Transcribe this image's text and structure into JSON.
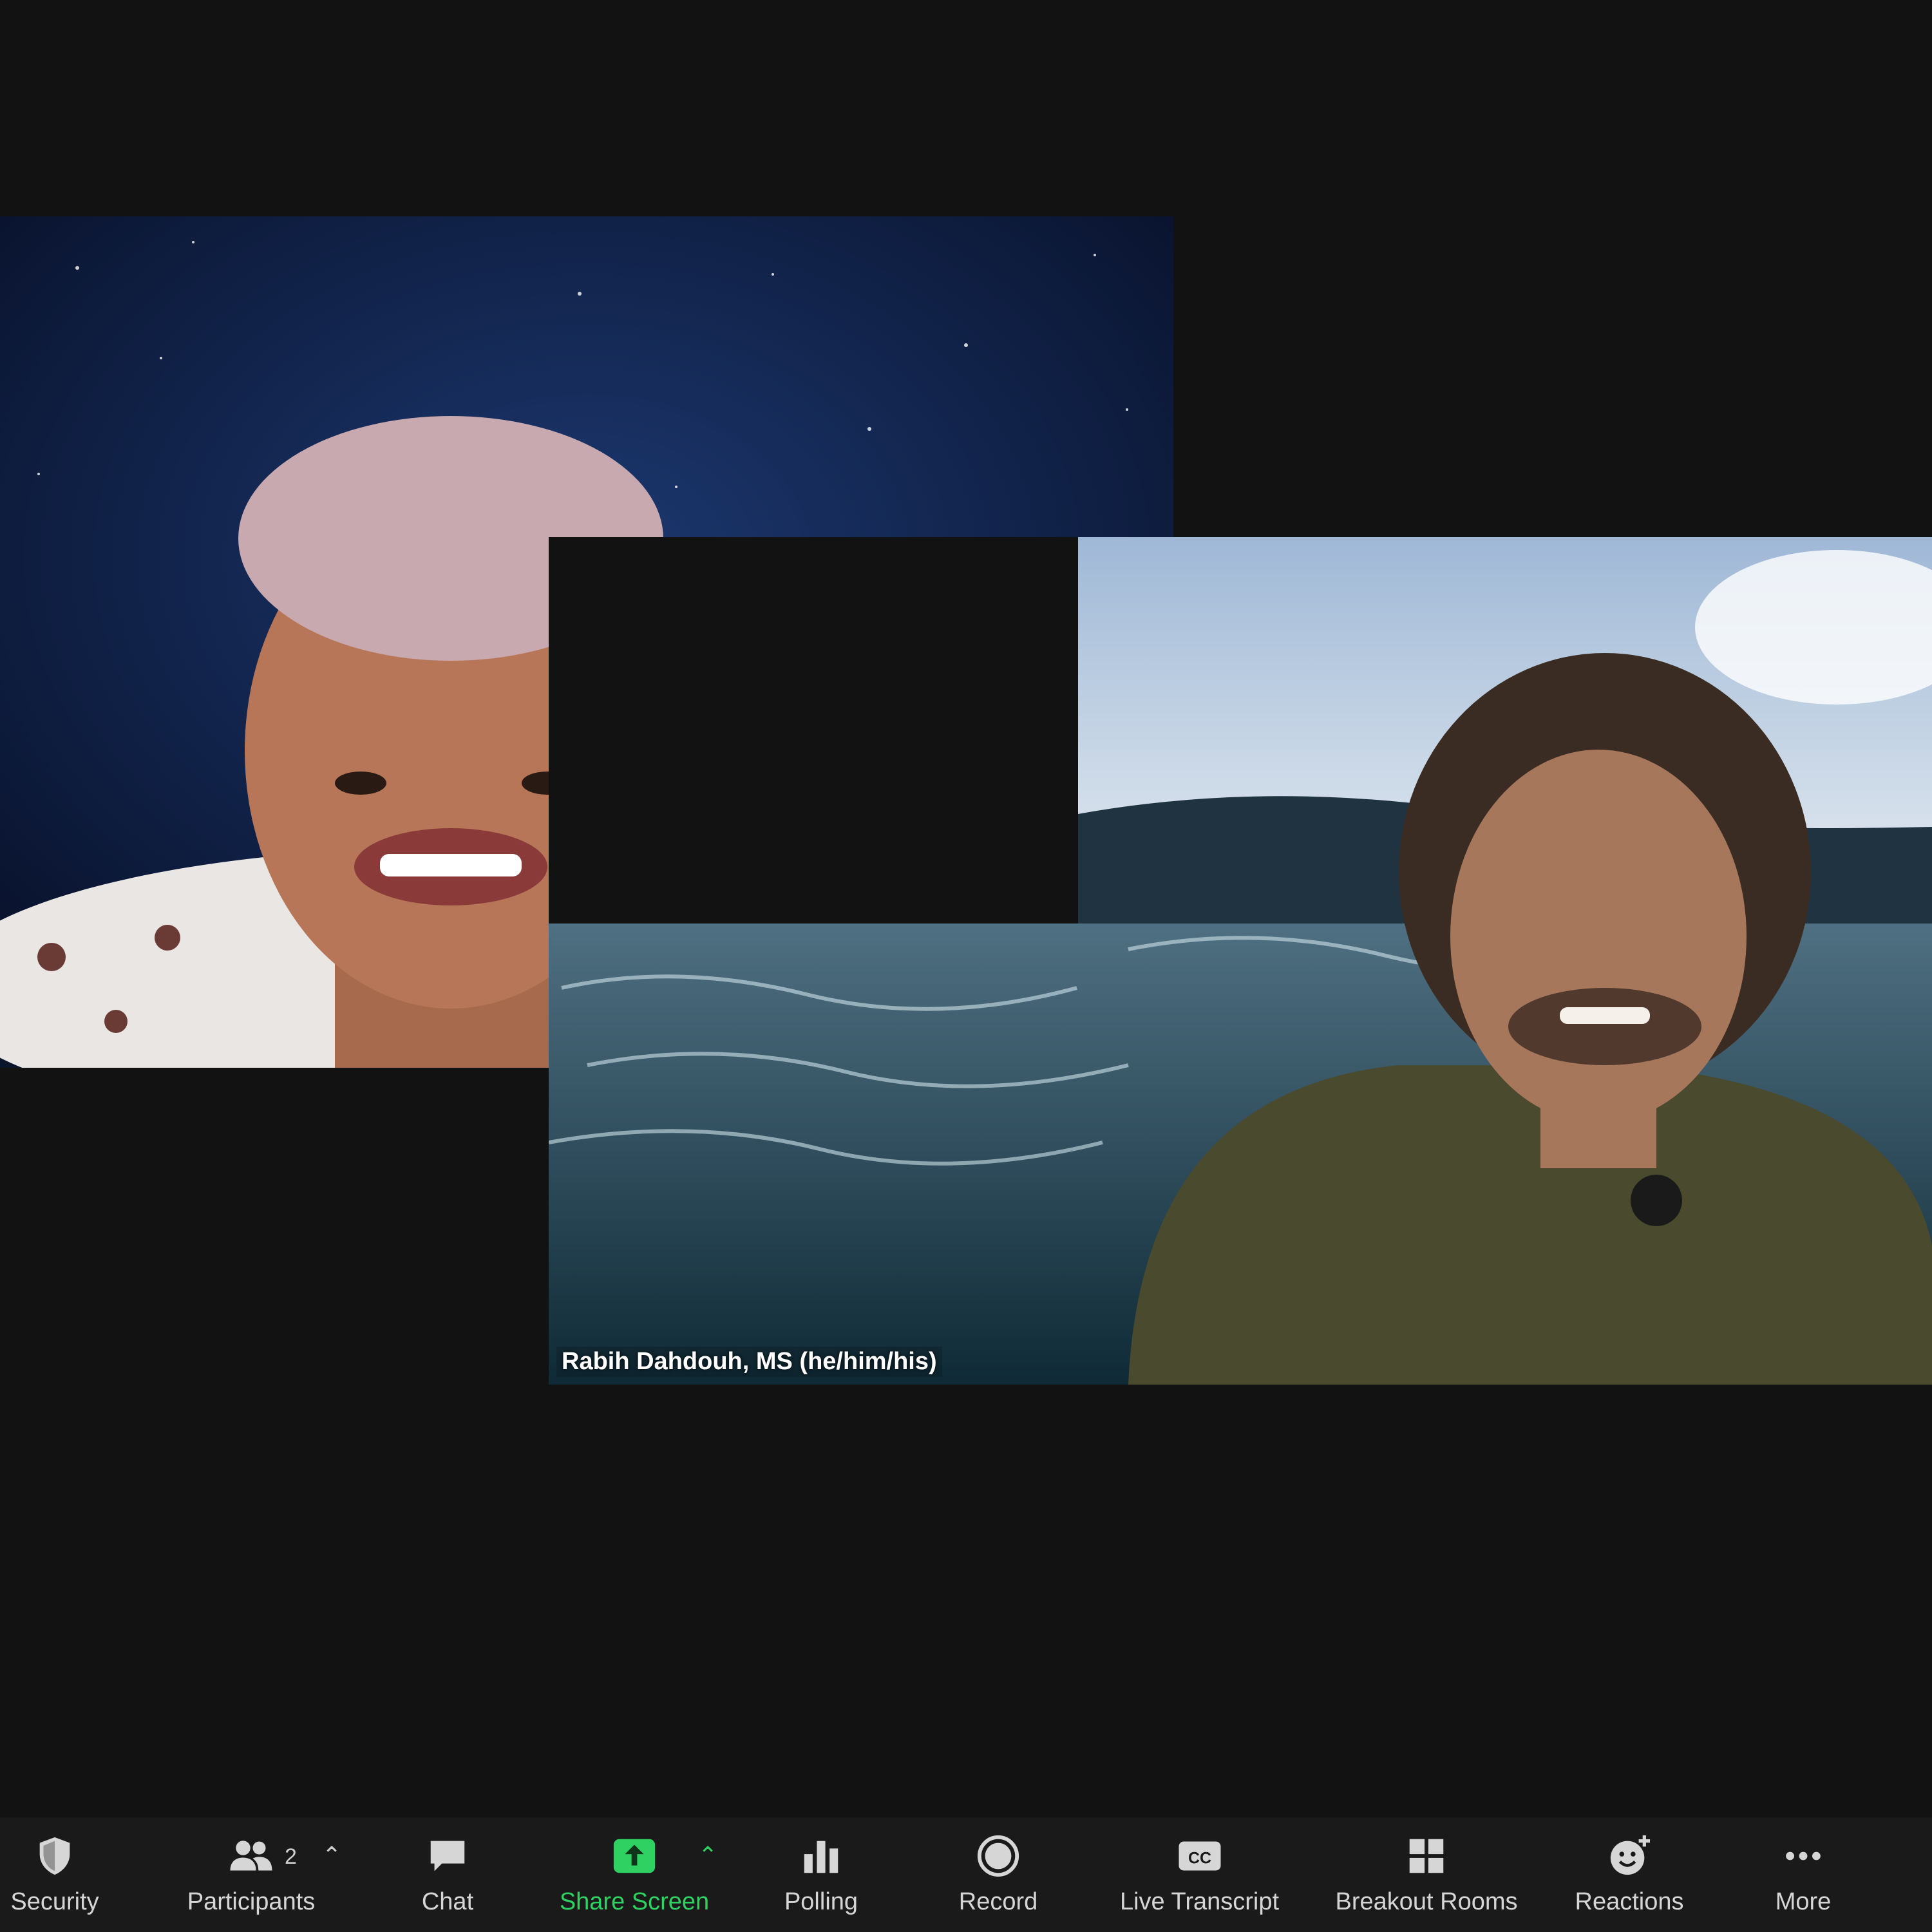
{
  "participants": [
    {
      "name": ""
    },
    {
      "name": "Rabih Dahdouh, MS (he/him/his)"
    }
  ],
  "toolbar": {
    "security": {
      "label": "Security",
      "icon": "shield-icon"
    },
    "participants": {
      "label": "Participants",
      "count": "2",
      "icon": "people-icon"
    },
    "chat": {
      "label": "Chat",
      "icon": "chat-bubble-icon"
    },
    "share_screen": {
      "label": "Share Screen",
      "icon": "share-arrow-icon",
      "color": "#2ed162"
    },
    "polling": {
      "label": "Polling",
      "icon": "bar-chart-icon"
    },
    "record": {
      "label": "Record",
      "icon": "record-icon"
    },
    "live_transcript": {
      "label": "Live Transcript",
      "icon": "cc-icon"
    },
    "breakout_rooms": {
      "label": "Breakout Rooms",
      "icon": "grid-icon"
    },
    "reactions": {
      "label": "Reactions",
      "icon": "emoji-plus-icon"
    },
    "more": {
      "label": "More",
      "icon": "ellipsis-icon"
    }
  },
  "colors": {
    "background": "#121212",
    "toolbar": "#1a1a1a",
    "accent_green": "#2ed162"
  }
}
